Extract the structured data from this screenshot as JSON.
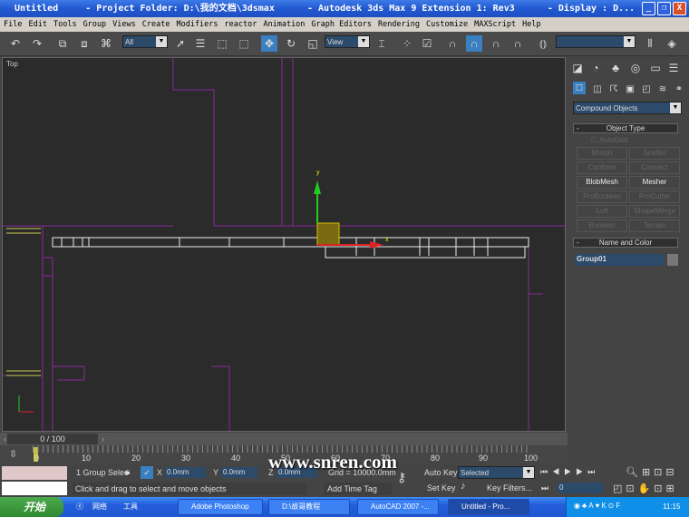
{
  "window": {
    "title": "Untitled     - Project Folder: D:\\我的文档\\3dsmax      - Autodesk 3ds Max 9 Extension 1: Rev3      - Display : D...",
    "min": "_",
    "max": "❐",
    "close": "X"
  },
  "menu": [
    "File",
    "Edit",
    "Tools",
    "Group",
    "Views",
    "Create",
    "Modifiers",
    "reactor",
    "Animation",
    "Graph Editors",
    "Rendering",
    "Customize",
    "MAXScript",
    "Help"
  ],
  "toolbar": {
    "selection_filter": "All",
    "ref_coord": "View",
    "named_sel": ""
  },
  "viewport": {
    "label": "Top",
    "axis_y": "y",
    "axis_x": "x"
  },
  "command_panel": {
    "category": "Compound Objects",
    "object_type_title": "Object Type",
    "autogrid": "AutoGrid",
    "buttons": [
      {
        "label": "Morph",
        "enabled": false
      },
      {
        "label": "Scatter",
        "enabled": false
      },
      {
        "label": "Conform",
        "enabled": false
      },
      {
        "label": "Connect",
        "enabled": false
      },
      {
        "label": "BlobMesh",
        "enabled": true
      },
      {
        "label": "Mesher",
        "enabled": true
      },
      {
        "label": "ProBoolean",
        "enabled": false
      },
      {
        "label": "ProCutter",
        "enabled": false
      },
      {
        "label": "Loft",
        "enabled": false
      },
      {
        "label": "ShapeMerge",
        "enabled": false
      },
      {
        "label": "Boolean",
        "enabled": false
      },
      {
        "label": "Terrain",
        "enabled": false
      }
    ],
    "name_color_title": "Name and Color",
    "object_name": "Group01"
  },
  "time": {
    "slider": "0 / 100",
    "ticks": [
      "0",
      "10",
      "20",
      "30",
      "40",
      "50",
      "60",
      "70",
      "80",
      "90",
      "100"
    ]
  },
  "status": {
    "selection": "1 Group Selec",
    "x": "0.0mm",
    "y": "0.0mm",
    "z": "0.0mm",
    "x_label": "X",
    "y_label": "Y",
    "z_label": "Z",
    "grid": "Grid = 10000.0mm",
    "prompt": "Click and drag to select and move objects",
    "add_time_tag": "Add Time Tag",
    "auto_key": "Auto Key",
    "set_key": "Set Key",
    "key_mode": "Selected",
    "key_filters": "Key Filters...",
    "frame": "0"
  },
  "watermark": "www.snren.com",
  "taskbar": {
    "start": "开始",
    "links": "网络",
    "tools": "工具",
    "tasks": [
      "Adobe Photoshop",
      "D:\\故哥教程",
      "AutoCAD 2007 -...",
      "Untitled    - Pro..."
    ],
    "clock": "11:15"
  }
}
